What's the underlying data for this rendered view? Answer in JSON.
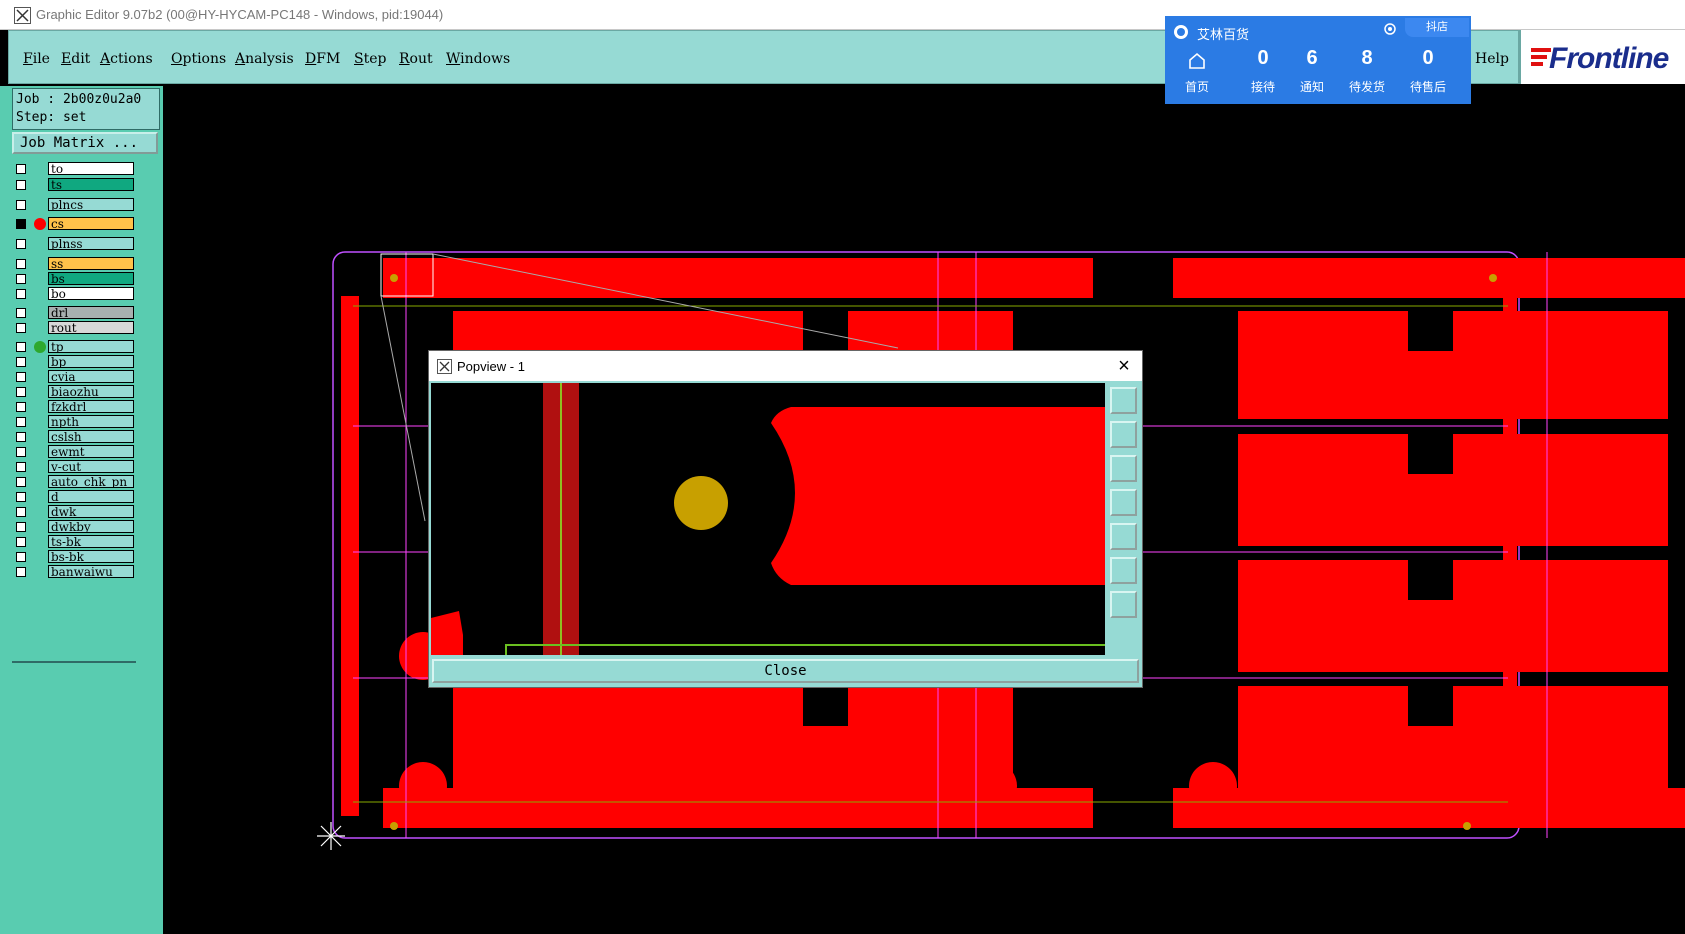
{
  "window": {
    "title": "Graphic Editor 9.07b2 (00@HY-HYCAM-PC148 - Windows, pid:19044)"
  },
  "menu": {
    "items": [
      "File",
      "Edit",
      "Actions",
      "Options",
      "Analysis",
      "DFM",
      "Step",
      "Rout",
      "Windows"
    ],
    "help": "Help"
  },
  "logo": {
    "text": "Frontline"
  },
  "job": {
    "job_line": "Job : 2b00z0u2a0",
    "step_line": "Step: set",
    "matrix_button": "Job Matrix ..."
  },
  "layers": [
    {
      "name": "to",
      "color": "#ffffff",
      "dot": ""
    },
    {
      "name": "ts",
      "color": "#10a880",
      "dot": ""
    },
    {
      "name": "plncs",
      "color": "#96dad4",
      "dot": ""
    },
    {
      "name": "cs",
      "color": "#ffc24a",
      "dot": "#ff0000",
      "active": true
    },
    {
      "name": "plnss",
      "color": "#96dad4",
      "dot": ""
    },
    {
      "name": "ss",
      "color": "#ffc24a",
      "dot": ""
    },
    {
      "name": "bs",
      "color": "#10a880",
      "dot": ""
    },
    {
      "name": "bo",
      "color": "#ffffff",
      "dot": ""
    },
    {
      "name": "drl",
      "color": "#a8b0b0",
      "dot": ""
    },
    {
      "name": "rout",
      "color": "#d8d8d8",
      "dot": ""
    },
    {
      "name": "tp",
      "color": "#96dad4",
      "dot": "#2ea82e"
    },
    {
      "name": "bp",
      "color": "#96dad4",
      "dot": ""
    },
    {
      "name": "cvia",
      "color": "#96dad4",
      "dot": ""
    },
    {
      "name": "biaozhu",
      "color": "#96dad4",
      "dot": ""
    },
    {
      "name": "fzkdrl",
      "color": "#96dad4",
      "dot": ""
    },
    {
      "name": "npth",
      "color": "#96dad4",
      "dot": ""
    },
    {
      "name": "cslsh",
      "color": "#96dad4",
      "dot": ""
    },
    {
      "name": "ewmt",
      "color": "#96dad4",
      "dot": ""
    },
    {
      "name": "v-cut",
      "color": "#96dad4",
      "dot": ""
    },
    {
      "name": "auto_chk_pn",
      "color": "#96dad4",
      "dot": ""
    },
    {
      "name": "d",
      "color": "#96dad4",
      "dot": ""
    },
    {
      "name": "dwk",
      "color": "#96dad4",
      "dot": ""
    },
    {
      "name": "dwkby",
      "color": "#96dad4",
      "dot": ""
    },
    {
      "name": "ts-bk",
      "color": "#96dad4",
      "dot": ""
    },
    {
      "name": "bs-bk",
      "color": "#96dad4",
      "dot": ""
    },
    {
      "name": "banwaiwu",
      "color": "#96dad4",
      "dot": ""
    }
  ],
  "popup": {
    "title": "艾林百货",
    "brand": "抖店",
    "home_label": "首页",
    "stats": [
      {
        "value": "0",
        "label": "接待"
      },
      {
        "value": "6",
        "label": "通知"
      },
      {
        "value": "8",
        "label": "待发货"
      },
      {
        "value": "0",
        "label": "待售后"
      }
    ]
  },
  "popview": {
    "title": "Popview - 1",
    "close_label": "Close"
  },
  "colors": {
    "copper": "#ff0000",
    "pad": "#c8a000",
    "outline": "#ff44ff",
    "panel": "#96dad4",
    "sidebar": "#59ccb0"
  }
}
